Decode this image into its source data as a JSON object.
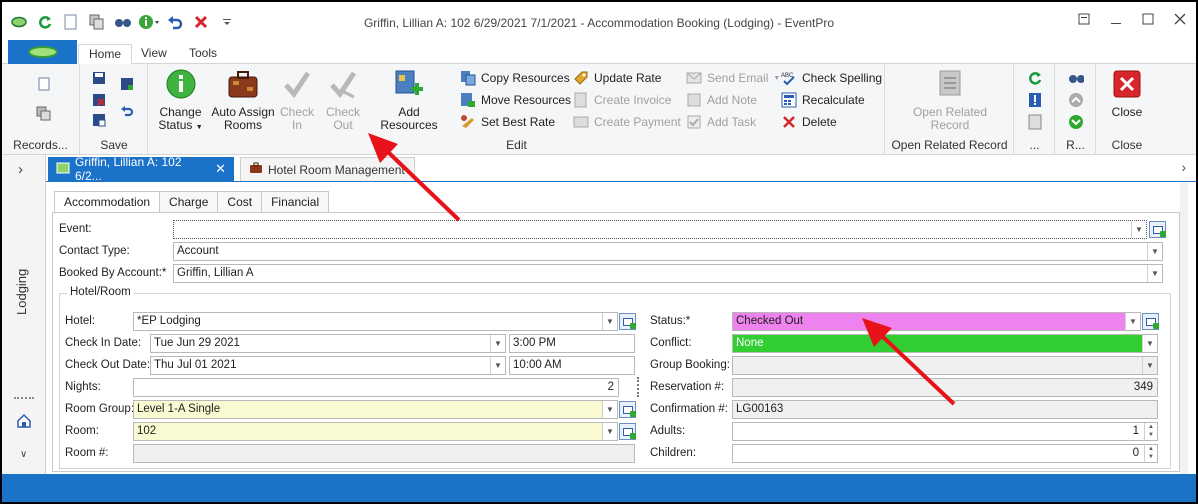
{
  "window": {
    "title": "Griffin, Lillian A: 102 6/29/2021 7/1/2021  - Accommodation Booking (Lodging) - EventPro"
  },
  "ribbon_tabs": [
    "Home",
    "View",
    "Tools"
  ],
  "ribbon": {
    "records_group": "Records...",
    "save_group": "Save",
    "edit_group": "Edit",
    "open_related_group": "Open Related Record",
    "more_group": "...",
    "r_group": "R...",
    "close_group": "Close",
    "change_status": [
      "Change",
      "Status"
    ],
    "auto_assign": [
      "Auto Assign",
      "Rooms"
    ],
    "check_in": [
      "Check",
      "In"
    ],
    "check_out": [
      "Check",
      "Out"
    ],
    "add_resources": "Add Resources",
    "copy_resources": "Copy Resources",
    "move_resources": "Move Resources",
    "set_best_rate": "Set Best Rate",
    "update_rate": "Update Rate",
    "create_invoice": "Create Invoice",
    "create_payment": "Create Payment",
    "send_email": "Send Email",
    "add_note": "Add Note",
    "add_task": "Add Task",
    "check_spelling": "Check Spelling",
    "recalculate": "Recalculate",
    "delete": "Delete",
    "open_related_record": [
      "Open Related",
      "Record"
    ],
    "close": "Close"
  },
  "doc_tabs": [
    "Griffin, Lillian A: 102 6/2...",
    "Hotel Room Management"
  ],
  "sidebar_label": "Lodging",
  "sub_tabs": [
    "Accommodation",
    "Charge",
    "Cost",
    "Financial"
  ],
  "form": {
    "event_label": "Event:",
    "event_value": "",
    "contact_type_label": "Contact Type:",
    "contact_type_value": "Account",
    "booked_by_label": "Booked By Account:*",
    "booked_by_value": "Griffin, Lillian A",
    "hotel_room_group": "Hotel/Room",
    "hotel_label": "Hotel:",
    "hotel_value": "*EP Lodging",
    "check_in_date_label": "Check In Date:",
    "check_in_date_value": "Tue Jun 29 2021",
    "check_in_time_value": "3:00 PM",
    "check_out_date_label": "Check Out Date:",
    "check_out_date_value": "Thu Jul 01 2021",
    "check_out_time_value": "10:00 AM",
    "nights_label": "Nights:",
    "nights_value": "2",
    "room_group_label": "Room Group:",
    "room_group_value": "Level 1-A Single",
    "room_label": "Room:",
    "room_value": "102",
    "room_num_label": "Room #:",
    "room_num_value": "",
    "status_label": "Status:*",
    "status_value": "Checked Out",
    "conflict_label": "Conflict:",
    "conflict_value": "None",
    "group_booking_label": "Group Booking:",
    "group_booking_value": "",
    "reservation_label": "Reservation #:",
    "reservation_value": "349",
    "confirmation_label": "Confirmation #:",
    "confirmation_value": "LG00163",
    "adults_label": "Adults:",
    "adults_value": "1",
    "children_label": "Children:",
    "children_value": "0"
  },
  "colors": {
    "accent": "#1a73c8",
    "status_checked_out": "#ee82ee",
    "conflict_none": "#32cd32",
    "required_field": "#fafad2",
    "annotation_arrow": "#e8121a"
  }
}
